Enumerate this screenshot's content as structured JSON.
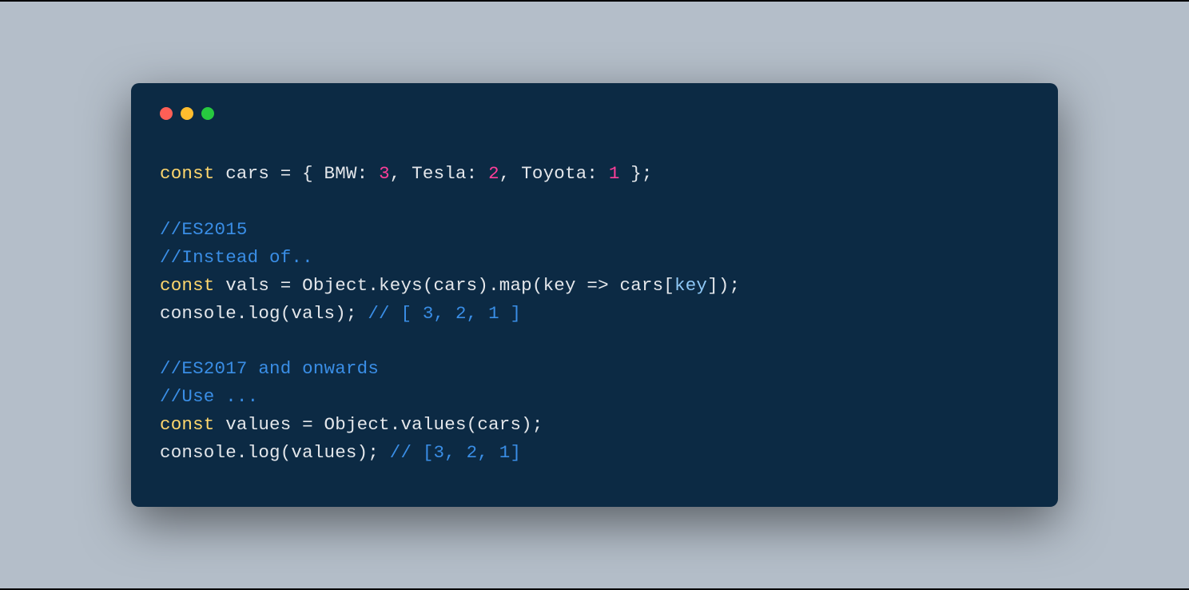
{
  "colors": {
    "red": "#ff5f56",
    "yellow": "#ffbd2e",
    "green": "#27c93f",
    "bg": "#0c2a44",
    "page": "#b4bec9"
  },
  "code": {
    "l1": {
      "const": "const",
      "rest1": " cars = { BMW: ",
      "n1": "3",
      "c1": ", Tesla: ",
      "n2": "2",
      "c2": ", Toyota: ",
      "n3": "1",
      "end": " };"
    },
    "l2": "",
    "l3": "//ES2015",
    "l4": "//Instead of..",
    "l5": {
      "const": "const",
      "mid": " vals = Object.keys(cars).map(key => cars[",
      "key": "key",
      "end": "]);"
    },
    "l6": {
      "a": "console.log(vals); ",
      "b": "// [ 3, 2, 1 ]"
    },
    "l7": "",
    "l8": "//ES2017 and onwards",
    "l9": "//Use ...",
    "l10": {
      "const": "const",
      "rest": " values = Object.values(cars);"
    },
    "l11": {
      "a": "console.log(values); ",
      "b": "// [3, 2, 1]"
    }
  }
}
